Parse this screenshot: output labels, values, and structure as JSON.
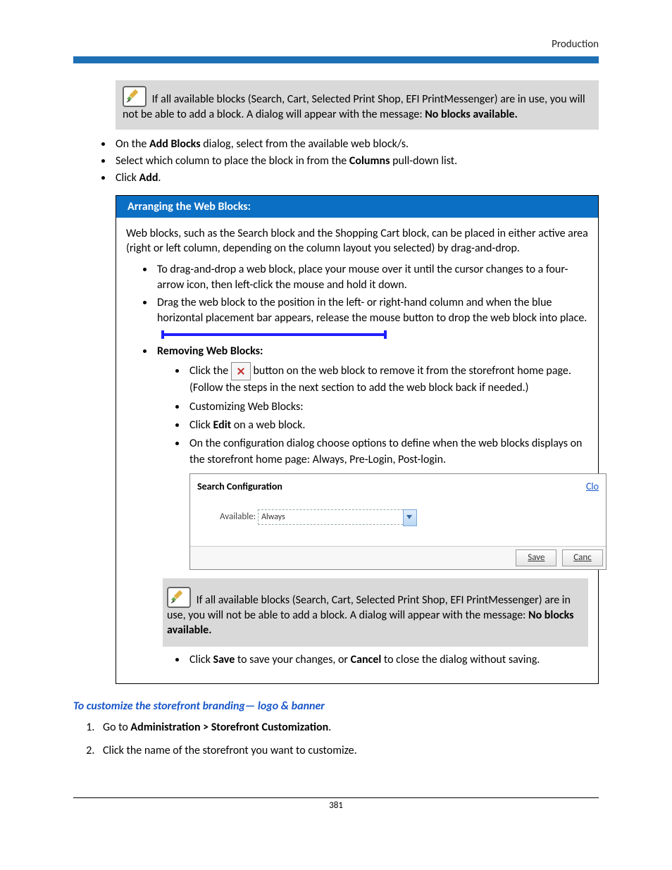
{
  "header": {
    "section": "Production"
  },
  "note1": {
    "pre": "If all available blocks (Search, Cart, Selected Print Shop, EFI PrintMessenger) are in use, you will not be able to add a block. A dialog will appear with the message: ",
    "bold": "No blocks available."
  },
  "topBullets": {
    "b1_pre": "On the ",
    "b1_bold": "Add Blocks",
    "b1_post": " dialog, select from the available web block/s.",
    "b2_pre": "Select which column to place the block in from the ",
    "b2_bold": "Columns",
    "b2_post": " pull-down list.",
    "b3_pre": "Click ",
    "b3_bold": "Add",
    "b3_post": "."
  },
  "panel": {
    "title": "Arranging the Web Blocks:",
    "intro": "Web blocks, such as the Search block and the Shopping Cart block, can be placed in either active area (right or left column, depending on the column layout you selected) by drag-and-drop.",
    "l1": "To drag-and-drop a web block, place your mouse over it until the cursor changes to a four-arrow icon, then left-click the mouse and hold it down.",
    "l2": "Drag the web block to the position in the left- or right-hand column and when the blue horizontal placement bar appears, release the mouse button to drop the web block into place.",
    "l3_bold": "Removing Web Blocks:",
    "s1_pre": "Click the ",
    "s1_post": " button on the web block to remove it from the storefront home page. (Follow the steps in the next section to add the web block back if needed.)",
    "s2": "Customizing Web Blocks:",
    "s3_pre": "Click ",
    "s3_bold": "Edit",
    "s3_post": " on a web block.",
    "s4": "On the configuration dialog choose options to define when the web blocks displays on the storefront home page: Always, Pre-Login, Post-login.",
    "config": {
      "title": "Search Configuration",
      "close": "Clo",
      "availLabel": "Available:",
      "availValue": "Always",
      "save": "Save",
      "cancel": "Canc"
    },
    "note2": {
      "pre": "If all available blocks (Search, Cart, Selected Print Shop, EFI PrintMessenger) are in use, you will not be able to add a block. A dialog will appear with the message: ",
      "bold": "No blocks available."
    },
    "final_pre": "Click ",
    "final_b1": "Save",
    "final_mid": " to save your changes, or ",
    "final_b2": "Cancel",
    "final_post": " to close the dialog without saving."
  },
  "branding": {
    "heading": "To customize the storefront branding— logo & banner",
    "step1_pre": "Go to ",
    "step1_bold": "Administration > Storefront Customization",
    "step1_post": ".",
    "step2": "Click the name of the storefront you want to customize."
  },
  "pageNumber": "381"
}
